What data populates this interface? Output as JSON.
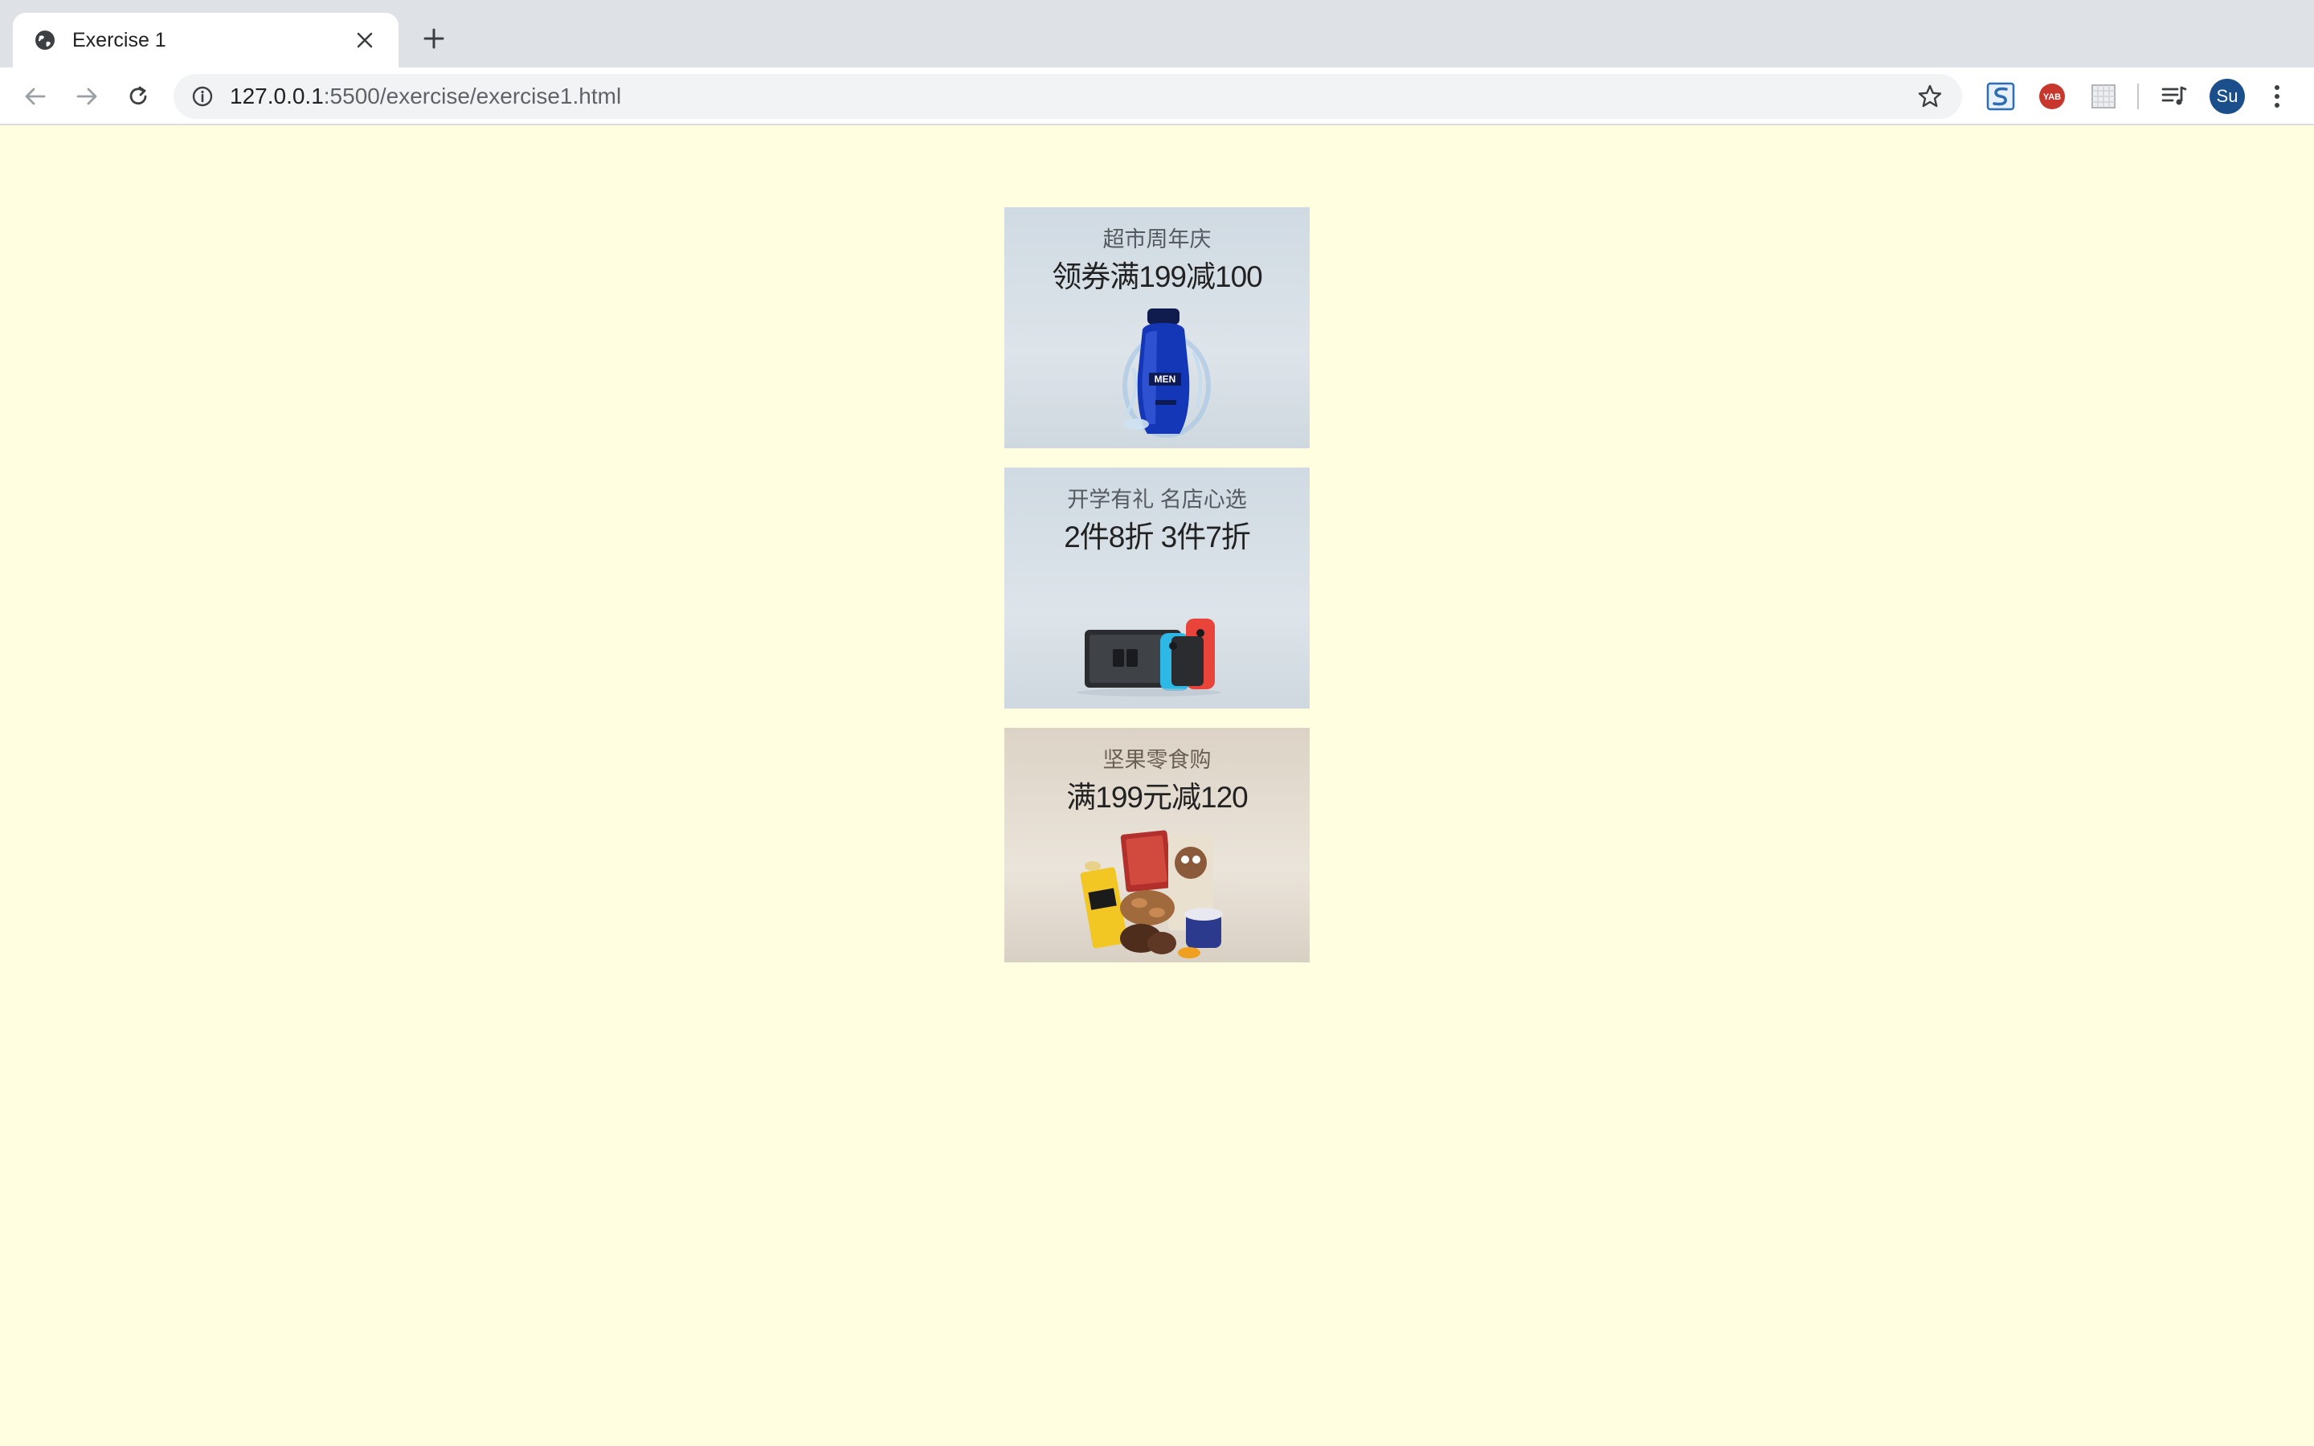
{
  "browser": {
    "tab": {
      "title": "Exercise 1",
      "favicon": "globe-icon",
      "close_icon": "close-icon"
    },
    "new_tab_icon": "plus-icon",
    "toolbar": {
      "back_icon": "arrow-left-icon",
      "forward_icon": "arrow-right-icon",
      "reload_icon": "reload-icon",
      "url_host": "127.0.0.1",
      "url_path": ":5500/exercise/exercise1.html",
      "site_info_icon": "info-icon",
      "bookmark_icon": "star-icon",
      "extensions": [
        {
          "name": "extension-s-icon",
          "color": "#2d6db5"
        },
        {
          "name": "extension-yab-icon",
          "label": "YAB",
          "color": "#c8372d"
        },
        {
          "name": "extension-grid-icon",
          "color": "#b0b4b9"
        }
      ],
      "media_icon": "playlist-icon",
      "profile_initials": "Su",
      "profile_color": "#1a4f8c",
      "menu_icon": "kebab-menu-icon"
    }
  },
  "page": {
    "background": "#fffee0",
    "promos": [
      {
        "subtitle": "超市周年庆",
        "headline": "领券满199减100",
        "image": "shampoo-bottle-image"
      },
      {
        "subtitle": "开学有礼 名店心选",
        "headline": "2件8折 3件7折",
        "image": "game-console-image"
      },
      {
        "subtitle": "坚果零食购",
        "headline": "满199元减120",
        "image": "snacks-image"
      }
    ]
  }
}
